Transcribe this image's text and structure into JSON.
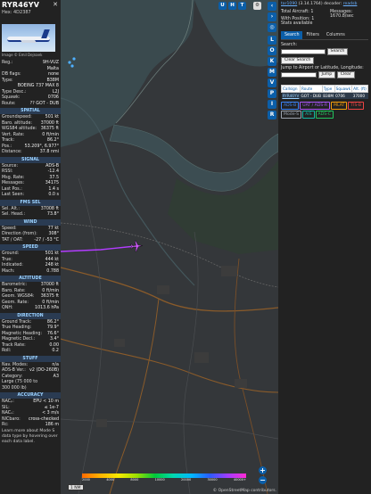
{
  "aircraft": {
    "callsign": "RYR46YV",
    "hex": "Hex: 4D2387",
    "photo_credit": "Image © Emil Dejnaek",
    "details": [
      {
        "k": "Reg.:",
        "v": "9H-VUZ"
      },
      {
        "k": "",
        "v": "Malta"
      },
      {
        "k": "DB flags:",
        "v": "none"
      },
      {
        "k": "Type:",
        "v": "B38M"
      },
      {
        "k": "",
        "v": "BOEING 737 MAX 8"
      },
      {
        "k": "Type Desc.:",
        "v": "L2J"
      },
      {
        "k": "Squawk:",
        "v": "0706"
      },
      {
        "k": "Route:",
        "v": "?? GOT - DUB"
      }
    ],
    "sections": [
      {
        "title": "SPATIAL",
        "rows": [
          {
            "k": "Groundspeed:",
            "v": "501 kt"
          },
          {
            "k": "Baro. altitude:",
            "v": "37000 ft"
          },
          {
            "k": "WGS84 altitude:",
            "v": "36375 ft"
          },
          {
            "k": "Vert. Rate:",
            "v": "0 ft/min"
          },
          {
            "k": "Track:",
            "v": "86.2°"
          },
          {
            "k": "Pos.:",
            "v": "53.209°, 6.977°"
          },
          {
            "k": "Distance:",
            "v": "37.8 nmi"
          }
        ]
      },
      {
        "title": "SIGNAL",
        "rows": [
          {
            "k": "Source:",
            "v": "ADS-B"
          },
          {
            "k": "RSSI:",
            "v": "-12.4"
          },
          {
            "k": "Msg. Rate:",
            "v": "37.5"
          },
          {
            "k": "Messages:",
            "v": "34175"
          },
          {
            "k": "Last Pos.:",
            "v": "1.4 s"
          },
          {
            "k": "Last Seen:",
            "v": "0.0 s"
          }
        ]
      },
      {
        "title": "FMS SEL",
        "rows": [
          {
            "k": "Sel. Alt.:",
            "v": "37008 ft"
          },
          {
            "k": "Sel. Head.:",
            "v": "73.8°"
          }
        ]
      },
      {
        "title": "WIND",
        "rows": [
          {
            "k": "Speed:",
            "v": "77 kt"
          },
          {
            "k": "Direction (from):",
            "v": "308°"
          },
          {
            "k": "TAT / OAT:",
            "v": "-27 / -53 °C"
          }
        ]
      },
      {
        "title": "SPEED",
        "rows": [
          {
            "k": "Ground:",
            "v": "501 kt"
          },
          {
            "k": "True:",
            "v": "444 kt"
          },
          {
            "k": "Indicated:",
            "v": "248 kt"
          },
          {
            "k": "Mach:",
            "v": "0.788"
          }
        ]
      },
      {
        "title": "ALTITUDE",
        "rows": [
          {
            "k": "Barometric:",
            "v": "37000 ft"
          },
          {
            "k": "Baro. Rate:",
            "v": "0 ft/min"
          },
          {
            "k": "Geom. WGS84:",
            "v": "36375 ft"
          },
          {
            "k": "Geom. Rate:",
            "v": "0 ft/min"
          },
          {
            "k": "QNH:",
            "v": "1013.6 hPa"
          }
        ]
      },
      {
        "title": "DIRECTION",
        "rows": [
          {
            "k": "Ground Track:",
            "v": "86.2°"
          },
          {
            "k": "True Heading:",
            "v": "79.9°"
          },
          {
            "k": "Magnetic Heading:",
            "v": "76.6°"
          },
          {
            "k": "Magnetic Decl.:",
            "v": "3.4°"
          },
          {
            "k": "Track Rate:",
            "v": "0.00"
          },
          {
            "k": "Roll:",
            "v": "0.2"
          }
        ]
      },
      {
        "title": "STUFF",
        "rows": [
          {
            "k": "Nav. Modes:",
            "v": "n/a"
          },
          {
            "k": "ADS-B Ver.:",
            "v": "v2 (DO-260B)"
          },
          {
            "k": "Category:",
            "v": "A3"
          },
          {
            "k": "Large (75 000 to",
            "v": ""
          },
          {
            "k": "300 000 lb)",
            "v": ""
          }
        ]
      },
      {
        "title": "ACCURACY",
        "rows": [
          {
            "k": "NACₚ:",
            "v": "EPU < 10 m"
          },
          {
            "k": "SIL:",
            "v": "≤ 1e-7"
          },
          {
            "k": "NACᵥ:",
            "v": "< 3 m/s"
          },
          {
            "k": "NICbaro:",
            "v": "cross-checked"
          },
          {
            "k": "Rᴄ:",
            "v": "186 m"
          }
        ]
      }
    ],
    "footer_note": "Learn more about Mode S data type by hovering over each data label."
  },
  "map": {
    "top_buttons": [
      "U",
      "H",
      "T"
    ],
    "scale_label": "1 NM",
    "attribution": "© OpenStreetMap contributors.",
    "altitude_labels": [
      "2000",
      "4000",
      "8000",
      "10000",
      "20000",
      "30000",
      "40000+"
    ],
    "zoom_in": "+",
    "zoom_out": "−"
  },
  "side_buttons": [
    "L",
    "O",
    "K",
    "M",
    "V",
    "P",
    "I",
    "R"
  ],
  "info": {
    "version_link": "tar1090",
    "version_text": "(3.14.1764) decoder:",
    "decoder_link": "readsb",
    "total_aircraft": "Total Aircraft: 1",
    "messages_label": "Messages:",
    "messages_value": "1670.8/sec",
    "with_position": "With Position: 1",
    "stats": "Stats available",
    "tabs": [
      "Search",
      "Filters",
      "Columns"
    ],
    "search_label": "Search:",
    "search_btn": "Search",
    "clear_search": "Clear Search",
    "jump_label": "Jump to Airport or Latitude, Longitude:",
    "jump_btn": "Jump",
    "clear_btn": "Clear",
    "table_headers": [
      "Callsign",
      "Route",
      "Type",
      "Squawk",
      "Alt. (ft)"
    ],
    "table_row": [
      "RYR46YV",
      "GOT - DUB",
      "B38M",
      "0706",
      "37000"
    ],
    "legend": [
      {
        "label": "ADS-B",
        "color": "#3b82f6"
      },
      {
        "label": "UAT / ADS-R",
        "color": "#a855f7"
      },
      {
        "label": "MLAT",
        "color": "#f59e0b"
      },
      {
        "label": "TIS-B",
        "color": "#ef4444"
      },
      {
        "label": "Mode-S",
        "color": "#9ca3af"
      },
      {
        "label": "AIS",
        "color": "#14b8a6"
      },
      {
        "label": "ADS-C",
        "color": "#22c55e"
      }
    ]
  }
}
